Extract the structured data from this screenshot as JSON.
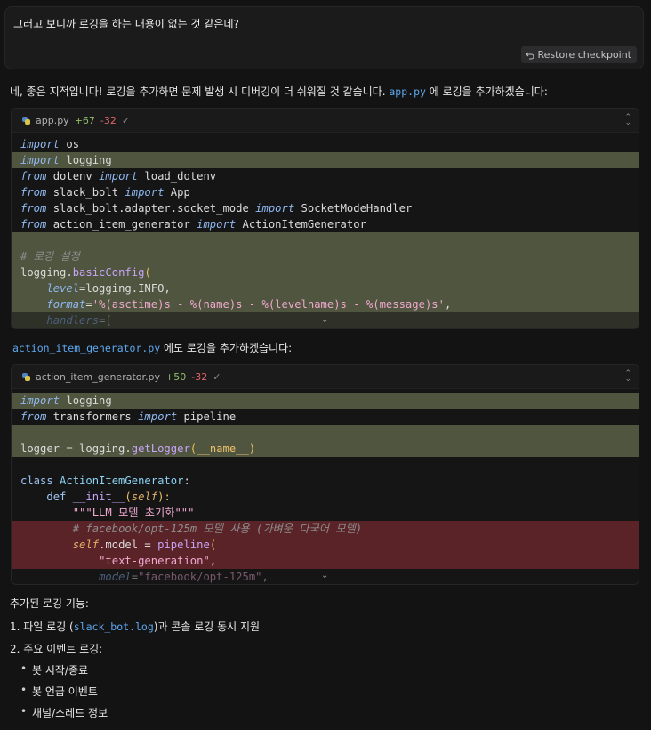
{
  "user_message": {
    "text": "그러고 보니까 로깅을 하는 내용이 없는 것 같은데?",
    "restore_label": "Restore checkpoint"
  },
  "assistant": {
    "intro_before": "네, 좋은 지적입니다! 로깅을 추가하면 문제 발생 시 디버깅이 더 쉬워질 것 같습니다.",
    "intro_file": "app.py",
    "intro_after": "에 로깅을 추가하겠습니다:",
    "second_file": "action_item_generator.py",
    "second_after": "에도 로깅을 추가하겠습니다:",
    "summary_title": "추가된 로깅 기능:",
    "item1_before": "1. 파일 로깅 (",
    "item1_code": "slack_bot.log",
    "item1_after": ")과 콘솔 로깅 동시 지원",
    "item2": "2. 주요 이벤트 로깅:",
    "bullets": [
      "봇 시작/종료",
      "봇 언급 이벤트",
      "채널/스레드 정보"
    ]
  },
  "card1": {
    "filename": "app.py",
    "added": "+67",
    "removed": "-32",
    "check": "✓"
  },
  "card2": {
    "filename": "action_item_generator.py",
    "added": "+50",
    "removed": "-32",
    "check": "✓"
  },
  "code1": {
    "l1_kw": "import",
    "l1_rest": " os",
    "l2_kw": "import",
    "l2_rest": " logging",
    "l3_kw": "from",
    "l3_mod": " dotenv ",
    "l3_kw2": "import",
    "l3_rest": " load_dotenv",
    "l4_kw": "from",
    "l4_mod": " slack_bolt ",
    "l4_kw2": "import",
    "l4_rest": " App",
    "l5_kw": "from",
    "l5_mod": " slack_bolt.adapter.socket_mode ",
    "l5_kw2": "import",
    "l5_rest": " SocketModeHandler",
    "l6_kw": "from",
    "l6_mod": " action_item_generator ",
    "l6_kw2": "import",
    "l6_rest": " ActionItemGenerator",
    "l8_cmt": "# 로깅 설정",
    "l9_a": "logging.",
    "l9_fn": "basicConfig",
    "l9_p": "(",
    "l10_indent": "    ",
    "l10_arg": "level",
    "l10_rest": "=logging.INFO,",
    "l11_indent": "    ",
    "l11_arg": "format",
    "l11_eq": "=",
    "l11_str": "'%(asctime)s - %(name)s - %(levelname)s - %(message)s'",
    "l11_end": ",",
    "l12_indent": "    ",
    "l12_arg": "handlers",
    "l12_rest": "=["
  },
  "code2": {
    "l1_kw": "import",
    "l1_rest": " logging",
    "l2_kw": "from",
    "l2_mod": " transformers ",
    "l2_kw2": "import",
    "l2_rest": " pipeline",
    "l4_a": "logger = logging.",
    "l4_fn": "getLogger",
    "l4_p1": "(",
    "l4_name": "__name__",
    "l4_p2": ")",
    "l6_kw": "class",
    "l6_cls": " ActionItemGenerator",
    "l6_end": ":",
    "l7_indent": "    ",
    "l7_kw": "def",
    "l7_fn": " __init__",
    "l7_p1": "(",
    "l7_self": "self",
    "l7_p2": "):",
    "l8_indent": "        ",
    "l8_str": "\"\"\"LLM 모델 초기화\"\"\"",
    "l9_indent": "        ",
    "l9_cmt": "# facebook/opt-125m 모델 사용 (가벼운 다국어 모델)",
    "l10_indent": "        ",
    "l10_self": "self",
    "l10_mid": ".model = ",
    "l10_fn": "pipeline",
    "l10_p": "(",
    "l11_indent": "            ",
    "l11_str": "\"text-generation\"",
    "l11_end": ",",
    "l12_indent": "            ",
    "l12_arg": "model",
    "l12_eq": "=",
    "l12_str": "\"facebook/opt-125m\"",
    "l12_end": ","
  },
  "colors": {
    "added_bg": "#4f553f",
    "removed_bg": "#5a2328",
    "inline_code": "#5ea8f0",
    "keyword": "#8fb8f0",
    "string": "#f0a8ce"
  }
}
